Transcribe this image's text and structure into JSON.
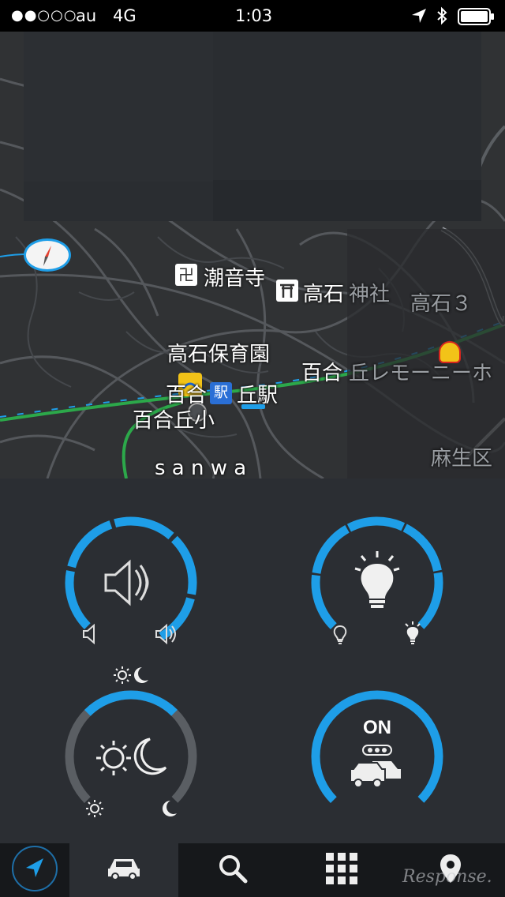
{
  "status_bar": {
    "signal": "●●○○○",
    "carrier": "au",
    "network": "4G",
    "time": "1:03",
    "icons": [
      "location-arrow-icon",
      "bluetooth-icon",
      "battery-icon"
    ]
  },
  "map": {
    "labels": {
      "temple": "潮音寺",
      "shrine_main": "高石",
      "shrine_suffix": "神社",
      "district": "高石３",
      "nursery": "高石保育園",
      "station_pre": "百合",
      "station_post": "丘駅",
      "school": "百合丘小",
      "right_yuri": "百合",
      "right_cut": "丘レモーニーホ",
      "asao": "麻生区",
      "sanwa": "s a n w a"
    },
    "compass_icon": "compass-icon"
  },
  "controls": {
    "volume": {
      "level": 1.0,
      "icon": "speaker-icon",
      "min_icon": "speaker-low-icon",
      "max_icon": "speaker-high-icon"
    },
    "brightness": {
      "level": 1.0,
      "icon": "bulb-icon",
      "min_icon": "bulb-dim-icon",
      "max_icon": "bulb-bright-icon"
    },
    "daynight": {
      "level": 0.5,
      "icon": "sun-moon-icon",
      "mode_icon": "sun-moon-icon",
      "min_icon": "sun-icon",
      "max_icon": "moon-icon"
    },
    "traffic": {
      "state_label": "ON",
      "level": 1.0,
      "icon": "traffic-jam-icon"
    }
  },
  "tabbar": {
    "items": [
      "navigate-icon",
      "car-icon",
      "search-icon",
      "grid-menu-icon",
      "location-pin-icon"
    ],
    "active": "car-icon"
  },
  "watermark": "Response.",
  "colors": {
    "accent": "#1e9ee8",
    "dial_inactive": "#5a5e63",
    "panel": "#2b2e33",
    "tabbar": "#16181b"
  }
}
